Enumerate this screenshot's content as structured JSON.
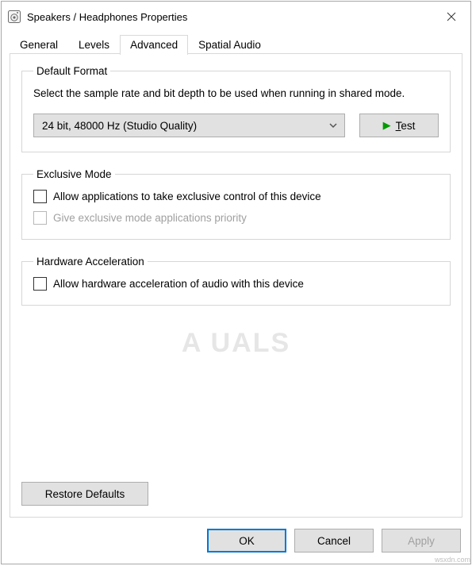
{
  "titlebar": {
    "icon_name": "speaker-icon",
    "title": "Speakers / Headphones Properties"
  },
  "tabs": [
    {
      "label": "General"
    },
    {
      "label": "Levels"
    },
    {
      "label": "Advanced"
    },
    {
      "label": "Spatial Audio"
    }
  ],
  "default_format": {
    "legend": "Default Format",
    "description": "Select the sample rate and bit depth to be used when running in shared mode.",
    "selected": "24 bit, 48000 Hz (Studio Quality)",
    "test_label": "Test"
  },
  "exclusive_mode": {
    "legend": "Exclusive Mode",
    "option1": "Allow applications to take exclusive control of this device",
    "option2": "Give exclusive mode applications priority"
  },
  "hardware_accel": {
    "legend": "Hardware Acceleration",
    "option1": "Allow hardware acceleration of audio with this device"
  },
  "restore_label": "Restore Defaults",
  "footer": {
    "ok": "OK",
    "cancel": "Cancel",
    "apply": "Apply"
  },
  "watermark": "A    UALS",
  "credit": "wsxdn.com"
}
